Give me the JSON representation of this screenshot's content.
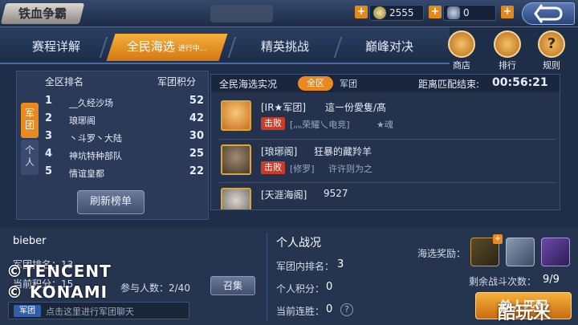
{
  "app": {
    "title": "铁血争霸"
  },
  "header": {
    "currency1": "2555",
    "currency2": "0"
  },
  "tabs": [
    {
      "label": "赛程详解"
    },
    {
      "label": "全民海选",
      "status": "进行中..."
    },
    {
      "label": "精英挑战"
    },
    {
      "label": "巅峰对决"
    }
  ],
  "right_icons": [
    {
      "label": "商店",
      "icon": "shop-icon"
    },
    {
      "label": "排行",
      "icon": "ranking-icon"
    },
    {
      "label": "规则",
      "icon": "rules-icon"
    }
  ],
  "leaderboard": {
    "side_tabs": [
      "军团",
      "个人"
    ],
    "col_rank": "全区排名",
    "col_points": "军团积分",
    "rows": [
      {
        "rank": "1",
        "name": "__久经沙场",
        "points": "52"
      },
      {
        "rank": "2",
        "name": "琅琊阁",
        "points": "42"
      },
      {
        "rank": "3",
        "name": "丶斗罗丶大陆",
        "points": "30"
      },
      {
        "rank": "4",
        "name": "神坑特种部队",
        "points": "25"
      },
      {
        "rank": "5",
        "name": "情谊皇都",
        "points": "22"
      }
    ],
    "refresh_label": "刷新榜单"
  },
  "live": {
    "title": "全民海选实况",
    "filter_all": "全区",
    "filter_legion": "军团",
    "countdown_label": "距离匹配结束:",
    "countdown": "00:56:21",
    "feed": [
      {
        "team": "[IR★军团]",
        "player": "這ー份愛隻/髙",
        "result": "击败",
        "opponent": "[灬荣耀乀电竞]",
        "opponent_player": "★魂"
      },
      {
        "team": "[琅琊阁]",
        "player": "狂暴的藏羚羊",
        "result": "击败",
        "opponent": "[修罗]",
        "opponent_player": "许许则为之"
      },
      {
        "team": "[天涯海阁]",
        "player": "9527",
        "result": "",
        "opponent": "",
        "opponent_player": ""
      }
    ]
  },
  "player": {
    "name": "bieber",
    "legion_rank_label": "军团排名：13",
    "current_points_label": "当前积分：15",
    "participants_label": "参与人数：2/40",
    "summon_label": "召集",
    "chat_tag": "军团",
    "chat_placeholder": "点击这里进行军团聊天"
  },
  "personal": {
    "title": "个人战况",
    "rank_label": "军团内排名：",
    "rank_value": "3",
    "points_label": "个人积分：",
    "points_value": "0",
    "streak_label": "当前连胜：",
    "streak_value": "0"
  },
  "rewards": {
    "label": "海选奖励：",
    "remaining_label": "剩余战斗次数：",
    "remaining_value": "9/9",
    "solo_button": "单人匹配"
  },
  "watermarks": {
    "tencent": "©TENCENT",
    "konami": "© KONAMI",
    "site": "酷玩米"
  },
  "colors": {
    "accent_orange": "#f0a030",
    "lose_red": "#c83c28",
    "bg_panel": "#2b3a58"
  }
}
